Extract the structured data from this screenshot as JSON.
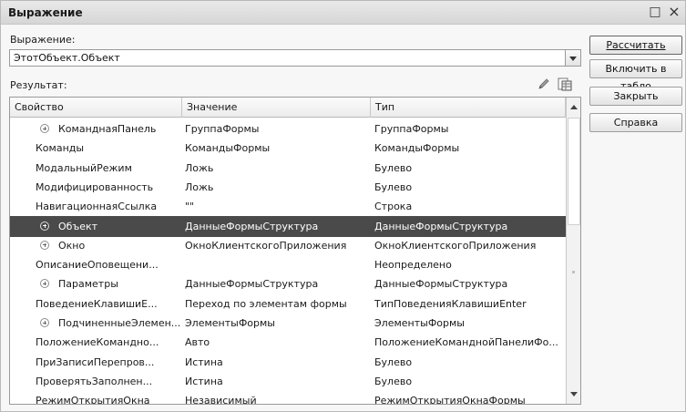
{
  "window": {
    "title": "Выражение",
    "maximize_glyph": "□",
    "close_glyph": "×"
  },
  "expression": {
    "label": "Выражение:",
    "value": "ЭтотОбъект.Объект"
  },
  "result": {
    "label": "Результат:"
  },
  "icons": {
    "edit": "pencil-icon",
    "output": "table-icon"
  },
  "table": {
    "columns": [
      "Свойство",
      "Значение",
      "Тип"
    ],
    "rows": [
      {
        "expandable": true,
        "selected": false,
        "property": "КоманднаяПанель",
        "value": "ГруппаФормы",
        "type": "ГруппаФормы"
      },
      {
        "expandable": false,
        "selected": false,
        "property": "Команды",
        "value": "КомандыФормы",
        "type": "КомандыФормы"
      },
      {
        "expandable": false,
        "selected": false,
        "property": "МодальныйРежим",
        "value": "Ложь",
        "type": "Булево"
      },
      {
        "expandable": false,
        "selected": false,
        "property": "Модифицированность",
        "value": "Ложь",
        "type": "Булево"
      },
      {
        "expandable": false,
        "selected": false,
        "property": "НавигационнаяСсылка",
        "value": "\"\"",
        "type": "Строка"
      },
      {
        "expandable": true,
        "selected": true,
        "property": "Объект",
        "value": "ДанныеФормыСтруктура",
        "type": "ДанныеФормыСтруктура"
      },
      {
        "expandable": true,
        "selected": false,
        "property": "Окно",
        "value": "ОкноКлиентскогоПриложения",
        "type": "ОкноКлиентскогоПриложения"
      },
      {
        "expandable": false,
        "selected": false,
        "property": "ОписаниеОповещени...",
        "value": "",
        "type": "Неопределено"
      },
      {
        "expandable": true,
        "selected": false,
        "property": "Параметры",
        "value": "ДанныеФормыСтруктура",
        "type": "ДанныеФормыСтруктура"
      },
      {
        "expandable": false,
        "selected": false,
        "property": "ПоведениеКлавишиЕ...",
        "value": "Переход по элементам формы",
        "type": "ТипПоведенияКлавишиEnter"
      },
      {
        "expandable": true,
        "selected": false,
        "property": "ПодчиненныеЭлемен...",
        "value": "ЭлементыФормы",
        "type": "ЭлементыФормы"
      },
      {
        "expandable": false,
        "selected": false,
        "property": "ПоложениеКомандно...",
        "value": "Авто",
        "type": "ПоложениеКоманднойПанелиФо..."
      },
      {
        "expandable": false,
        "selected": false,
        "property": "ПриЗаписиПерепров...",
        "value": "Истина",
        "type": "Булево"
      },
      {
        "expandable": false,
        "selected": false,
        "property": "ПроверятьЗаполнен...",
        "value": "Истина",
        "type": "Булево"
      },
      {
        "expandable": false,
        "selected": false,
        "property": "РежимОткрытияОкна",
        "value": "Независимый",
        "type": "РежимОткрытияОкнаФормы"
      }
    ]
  },
  "buttons": {
    "calculate": "Рассчитать",
    "include_in_table": "Включить в табло",
    "close": "Закрыть",
    "help": "Справка"
  },
  "colors": {
    "selection": "#4a4a4a",
    "window_bg": "#f7f7f7"
  }
}
